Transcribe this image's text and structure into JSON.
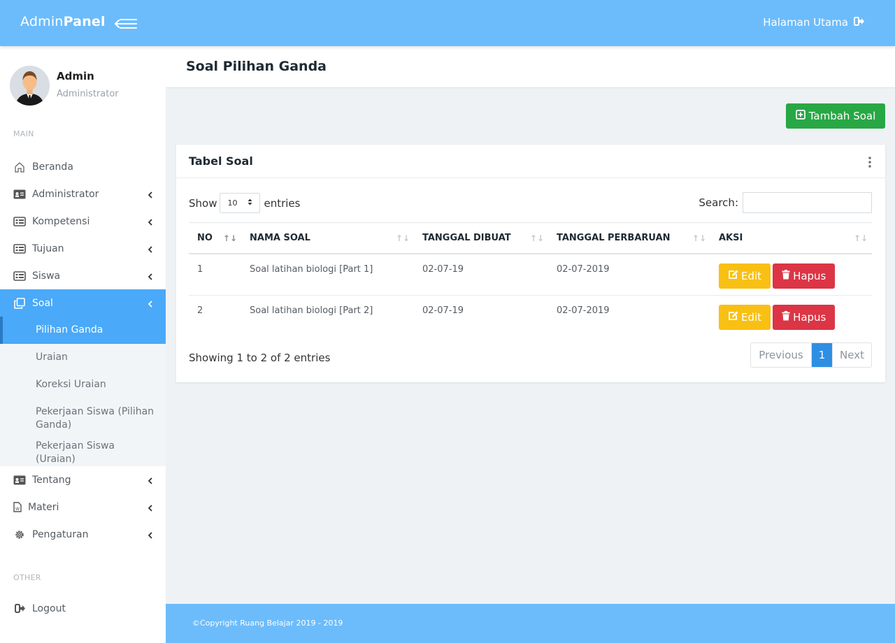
{
  "brand": {
    "part1": "Admin",
    "part2": "Panel"
  },
  "topbar": {
    "home_label": "Halaman Utama"
  },
  "profile": {
    "name": "Admin",
    "role": "Administrator"
  },
  "sections": {
    "main": "MAIN",
    "other": "OTHER"
  },
  "sidebar": {
    "items": [
      {
        "label": "Beranda",
        "icon": "home-icon"
      },
      {
        "label": "Administrator",
        "icon": "id-card-icon"
      },
      {
        "label": "Kompetensi",
        "icon": "list-card-icon"
      },
      {
        "label": "Tujuan",
        "icon": "list-card-icon"
      },
      {
        "label": "Siswa",
        "icon": "list-card-icon"
      },
      {
        "label": "Soal",
        "icon": "copy-icon"
      },
      {
        "label": "Tentang",
        "icon": "id-card-icon"
      },
      {
        "label": "Materi",
        "icon": "word-file-icon"
      },
      {
        "label": "Pengaturan",
        "icon": "gear-icon"
      }
    ],
    "soal_sub": [
      {
        "label": "Pilihan Ganda"
      },
      {
        "label": "Uraian"
      },
      {
        "label": "Koreksi Uraian"
      },
      {
        "label": "Pekerjaan Siswa (Pilihan Ganda)"
      },
      {
        "label": "Pekerjaan Siswa (Uraian)"
      }
    ],
    "logout": "Logout"
  },
  "page": {
    "title": "Soal Pilihan Ganda",
    "add_button": "Tambah Soal"
  },
  "card": {
    "title": "Tabel Soal"
  },
  "table_controls": {
    "show": "Show",
    "entries_value": "10",
    "entries": "entries",
    "search_label": "Search:"
  },
  "table": {
    "headers": [
      "NO",
      "NAMA SOAL",
      "TANGGAL DIBUAT",
      "TANGGAL PERBARUAN",
      "AKSI"
    ],
    "rows": [
      {
        "no": "1",
        "nama": "Soal latihan biologi [Part 1]",
        "dibuat": "02-07-19",
        "perbaruan": "02-07-2019"
      },
      {
        "no": "2",
        "nama": "Soal latihan biologi [Part 2]",
        "dibuat": "02-07-19",
        "perbaruan": "02-07-2019"
      }
    ],
    "edit_label": "Edit",
    "delete_label": "Hapus"
  },
  "pagination": {
    "info": "Showing 1 to 2 of 2 entries",
    "previous": "Previous",
    "current": "1",
    "next": "Next"
  },
  "footer": {
    "text": "©Copyright Ruang Belajar 2019 - 2019"
  },
  "colors": {
    "topbar": "#6cbcfb",
    "active": "#4aa9f8",
    "success": "#28a745",
    "warning": "#f9c014",
    "danger": "#dc3545"
  }
}
